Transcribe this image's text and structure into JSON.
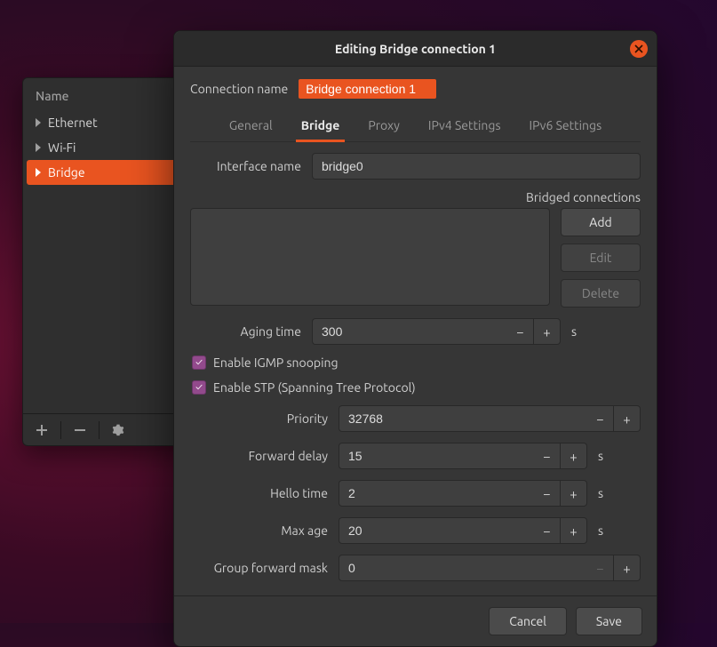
{
  "conn_window": {
    "header": "Name",
    "items": [
      "Ethernet",
      "Wi-Fi",
      "Bridge"
    ],
    "selected_index": 2
  },
  "dialog": {
    "title": "Editing Bridge connection 1",
    "connection_name_label": "Connection name",
    "connection_name_value": "Bridge connection 1",
    "tabs": [
      "General",
      "Bridge",
      "Proxy",
      "IPv4 Settings",
      "IPv6 Settings"
    ],
    "active_tab_index": 1,
    "interface_name_label": "Interface name",
    "interface_name_value": "bridge0",
    "bridged_connections_label": "Bridged connections",
    "buttons": {
      "add": "Add",
      "edit": "Edit",
      "delete": "Delete"
    },
    "aging_time": {
      "label": "Aging time",
      "value": "300",
      "unit": "s"
    },
    "igmp": {
      "label": "Enable IGMP snooping",
      "checked": true
    },
    "stp": {
      "label": "Enable STP (Spanning Tree Protocol)",
      "checked": true
    },
    "priority": {
      "label": "Priority",
      "value": "32768"
    },
    "forward_delay": {
      "label": "Forward delay",
      "value": "15",
      "unit": "s"
    },
    "hello_time": {
      "label": "Hello time",
      "value": "2",
      "unit": "s"
    },
    "max_age": {
      "label": "Max age",
      "value": "20",
      "unit": "s"
    },
    "group_forward_mask": {
      "label": "Group forward mask",
      "value": "0"
    },
    "footer": {
      "cancel": "Cancel",
      "save": "Save"
    }
  }
}
